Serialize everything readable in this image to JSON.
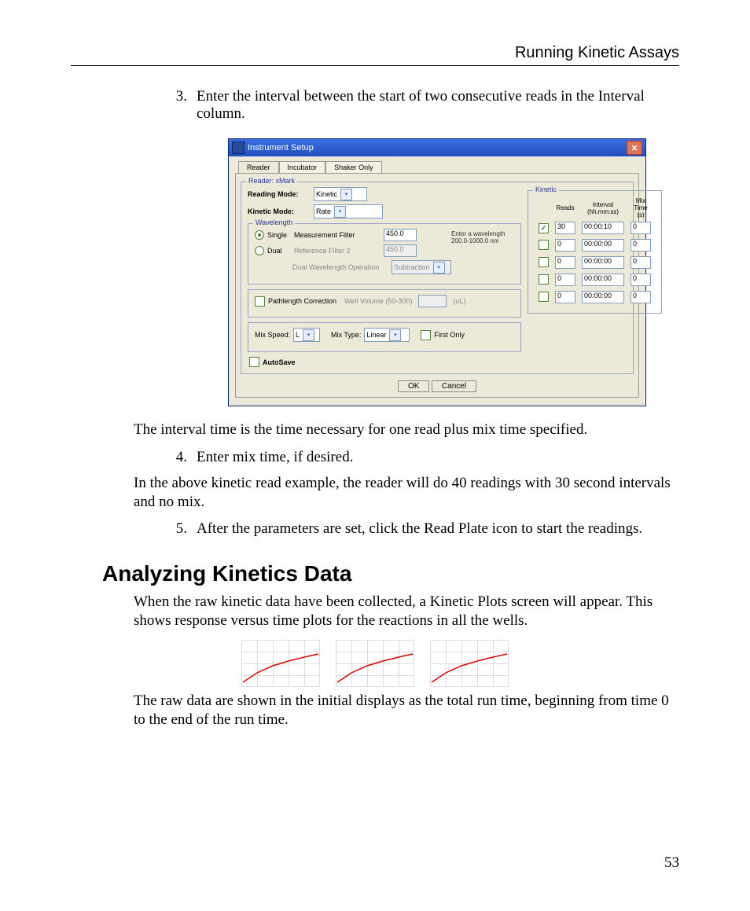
{
  "page": {
    "running_head": "Running Kinetic Assays",
    "pagenum": "53",
    "heading_analyzing": "Analyzing Kinetics Data",
    "para_interval": "The interval time is the time necessary for one read plus mix time specified.",
    "para_example": "In the above kinetic read example, the reader will do 40 readings with 30 second intervals and no mix.",
    "para_raw1": "When the raw kinetic data have been collected, a Kinetic Plots screen will appear. This shows response versus time plots for the reactions in all the wells.",
    "para_raw2": "The raw data are shown in the initial displays as the total run time, beginning from time 0 to the end of the run time.",
    "steps": {
      "n3": "3.",
      "t3": "Enter the interval between the start of two consecutive reads in the Interval column.",
      "n4": "4.",
      "t4": "Enter mix time, if desired.",
      "n5": "5.",
      "t5": "After the parameters are set, click the Read Plate icon to start the readings."
    }
  },
  "dlg": {
    "title": "Instrument Setup",
    "tabs": {
      "reader": "Reader",
      "incubator": "Incubator",
      "shaker": "Shaker Only"
    },
    "reader_legend": "Reader: xMark",
    "reading_mode_label": "Reading Mode:",
    "reading_mode_value": "Kinetic",
    "kinetic_mode_label": "Kinetic Mode:",
    "kinetic_mode_value": "Rate",
    "wavelength_legend": "Wavelength",
    "single_label": "Single",
    "dual_label": "Dual",
    "meas_filter_label": "Measurement Filter",
    "meas_filter_value": "450.0",
    "ref_filter_label": "Reference Filter 2",
    "ref_filter_value": "450.0",
    "dual_op_label": "Dual Wavelength Operation",
    "dual_op_value": "Subtraction",
    "wl_note1": "Enter a wavelength",
    "wl_note2": "200.0-1000.0 nm",
    "pathlength_label": "Pathlength Correction",
    "well_volume_label": "Well Volume (50-300)",
    "well_volume_unit": "(uL)",
    "mixspeed_label": "Mix Speed:",
    "mixspeed_value": "L",
    "mixtype_label": "Mix Type:",
    "mixtype_value": "Linear",
    "firstonly_label": "First Only",
    "autosave_label": "AutoSave",
    "kinetic_legend": "Kinetic",
    "headers": {
      "reads": "Reads",
      "interval": "Interval (hh:mm:ss)",
      "mix": "Mix Time (s)"
    },
    "rows": [
      {
        "enabled": true,
        "reads": "30",
        "interval": "00:00:10",
        "mix": "0"
      },
      {
        "enabled": false,
        "reads": "0",
        "interval": "00:00:00",
        "mix": "0"
      },
      {
        "enabled": false,
        "reads": "0",
        "interval": "00:00:00",
        "mix": "0"
      },
      {
        "enabled": false,
        "reads": "0",
        "interval": "00:00:00",
        "mix": "0"
      },
      {
        "enabled": false,
        "reads": "0",
        "interval": "00:00:00",
        "mix": "0"
      }
    ],
    "ok": "OK",
    "cancel": "Cancel"
  }
}
